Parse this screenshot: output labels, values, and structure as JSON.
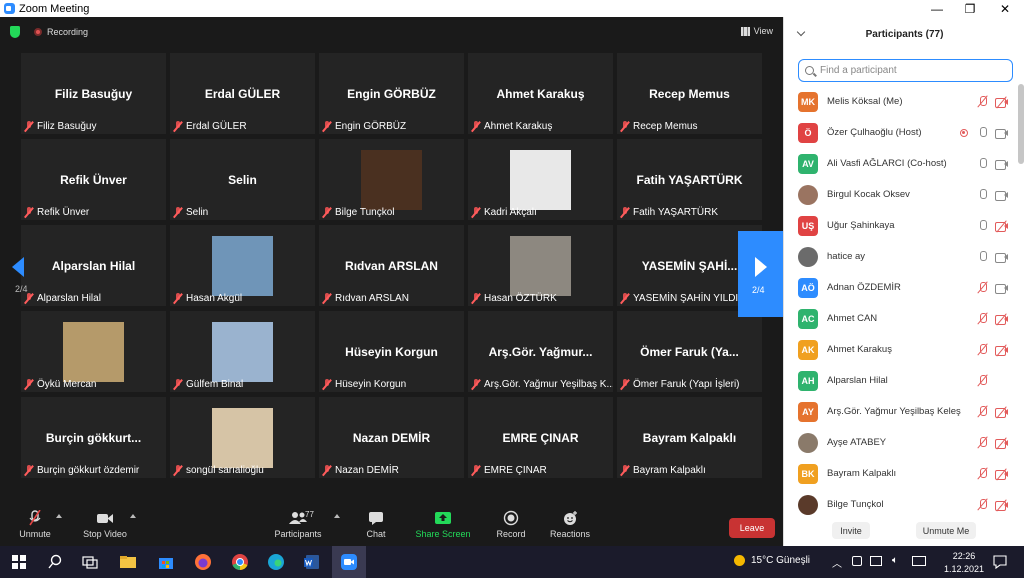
{
  "window": {
    "title": "Zoom Meeting"
  },
  "top": {
    "recording_label": "Recording",
    "view_label": "View"
  },
  "pager": {
    "left": "2/4",
    "right": "2/4"
  },
  "tiles": [
    {
      "big": "Filiz Basuğuy",
      "name": "Filiz Basuğuy",
      "video": false
    },
    {
      "big": "Erdal GÜLER",
      "name": "Erdal GÜLER",
      "video": false
    },
    {
      "big": "Engin GÖRBÜZ",
      "name": "Engin GÖRBÜZ",
      "video": false
    },
    {
      "big": "Ahmet Karakuş",
      "name": "Ahmet Karakuş",
      "video": false
    },
    {
      "big": "Recep Memus",
      "name": "Recep Memus",
      "video": false
    },
    {
      "big": "Refik Ünver",
      "name": "Refik Ünver",
      "video": false
    },
    {
      "big": "Selin",
      "name": "Selin",
      "video": false
    },
    {
      "big": "",
      "name": "Bilge Tunçkol",
      "video": true,
      "photo_color": "#4a3020"
    },
    {
      "big": "",
      "name": "Kadri Akçalı",
      "video": true,
      "photo_color": "#e8e8e8"
    },
    {
      "big": "Fatih YAŞARTÜRK",
      "name": "Fatih YAŞARTÜRK",
      "video": false
    },
    {
      "big": "Alparslan Hilal",
      "name": "Alparslan Hilal",
      "video": false
    },
    {
      "big": "",
      "name": "Hasan Akgül",
      "video": true,
      "photo_color": "#6f95b8"
    },
    {
      "big": "Rıdvan ARSLAN",
      "name": "Rıdvan ARSLAN",
      "video": false
    },
    {
      "big": "",
      "name": "Hasan ÖZTÜRK",
      "video": true,
      "photo_color": "#8d8880"
    },
    {
      "big": "YASEMİN ŞAHİ...",
      "name": "YASEMİN ŞAHİN YILDIZ",
      "video": false
    },
    {
      "big": "",
      "name": "Öykü Mercan",
      "video": true,
      "photo_color": "#b59a6a"
    },
    {
      "big": "",
      "name": "Gülfem Binal",
      "video": true,
      "photo_color": "#9ab3cf"
    },
    {
      "big": "Hüseyin Korgun",
      "name": "Hüseyin Korgun",
      "video": false
    },
    {
      "big": "Arş.Gör. Yağmur...",
      "name": "Arş.Gör. Yağmur Yeşilbaş K...",
      "video": false
    },
    {
      "big": "Ömer Faruk (Ya...",
      "name": "Ömer Faruk (Yapı İşleri)",
      "video": false
    },
    {
      "big": "Burçin gökkurt...",
      "name": "Burçin gökkurt özdemir",
      "video": false
    },
    {
      "big": "",
      "name": "songül sarıalioğlu",
      "video": true,
      "photo_color": "#d6c4a6"
    },
    {
      "big": "Nazan DEMİR",
      "name": "Nazan DEMİR",
      "video": false
    },
    {
      "big": "EMRE ÇINAR",
      "name": "EMRE ÇINAR",
      "video": false
    },
    {
      "big": "Bayram Kalpaklı",
      "name": "Bayram Kalpaklı",
      "video": false
    }
  ],
  "toolbar": {
    "unmute": "Unmute",
    "stop_video": "Stop Video",
    "participants": "Participants",
    "participants_count": "77",
    "chat": "Chat",
    "share_screen": "Share Screen",
    "record": "Record",
    "reactions": "Reactions",
    "leave": "Leave"
  },
  "panel": {
    "title": "Participants (77)",
    "search_placeholder": "Find a participant",
    "invite": "Invite",
    "unmute_me": "Unmute Me",
    "participants": [
      {
        "initials": "MK",
        "color": "#e5732e",
        "name": "Melis Köksal (Me)",
        "mic": "muted",
        "cam": "off",
        "rec": false
      },
      {
        "initials": "Ö",
        "color": "#e04343",
        "name": "Özer Çulhaoğlu (Host)",
        "mic": "on",
        "cam": "on",
        "rec": true
      },
      {
        "initials": "AV",
        "color": "#2fb36e",
        "name": "Ali Vasfi AĞLARCI (Co-host)",
        "mic": "on",
        "cam": "on",
        "rec": false
      },
      {
        "initials": "",
        "color": "#9a7461",
        "name": "Birgul Kocak Oksev",
        "mic": "on",
        "cam": "on",
        "rec": false
      },
      {
        "initials": "UŞ",
        "color": "#e04343",
        "name": "Uğur Şahinkaya",
        "mic": "on",
        "cam": "off",
        "rec": false
      },
      {
        "initials": "",
        "color": "#6b6b6b",
        "name": "hatice ay",
        "mic": "on",
        "cam": "on",
        "rec": false
      },
      {
        "initials": "AÖ",
        "color": "#2d8cff",
        "name": "Adnan ÖZDEMİR",
        "mic": "muted",
        "cam": "on",
        "rec": false
      },
      {
        "initials": "AC",
        "color": "#2fb36e",
        "name": "Ahmet CAN",
        "mic": "muted",
        "cam": "off",
        "rec": false
      },
      {
        "initials": "AK",
        "color": "#f0a020",
        "name": "Ahmet Karakuş",
        "mic": "muted",
        "cam": "off",
        "rec": false
      },
      {
        "initials": "AH",
        "color": "#2fb36e",
        "name": "Alparslan Hilal",
        "mic": "muted",
        "cam": "none",
        "rec": false
      },
      {
        "initials": "AY",
        "color": "#e5732e",
        "name": "Arş.Gör. Yağmur Yeşilbaş Keleş",
        "mic": "muted",
        "cam": "off",
        "rec": false
      },
      {
        "initials": "",
        "color": "#8a7a6a",
        "name": "Ayşe ATABEY",
        "mic": "muted",
        "cam": "off",
        "rec": false
      },
      {
        "initials": "BK",
        "color": "#f0a020",
        "name": "Bayram Kalpaklı",
        "mic": "muted",
        "cam": "off",
        "rec": false
      },
      {
        "initials": "",
        "color": "#5a3a2a",
        "name": "Bilge Tunçkol",
        "mic": "muted",
        "cam": "off",
        "rec": false
      }
    ]
  },
  "taskbar": {
    "weather": "15°C Güneşli",
    "time": "22:26",
    "date": "1.12.2021"
  }
}
